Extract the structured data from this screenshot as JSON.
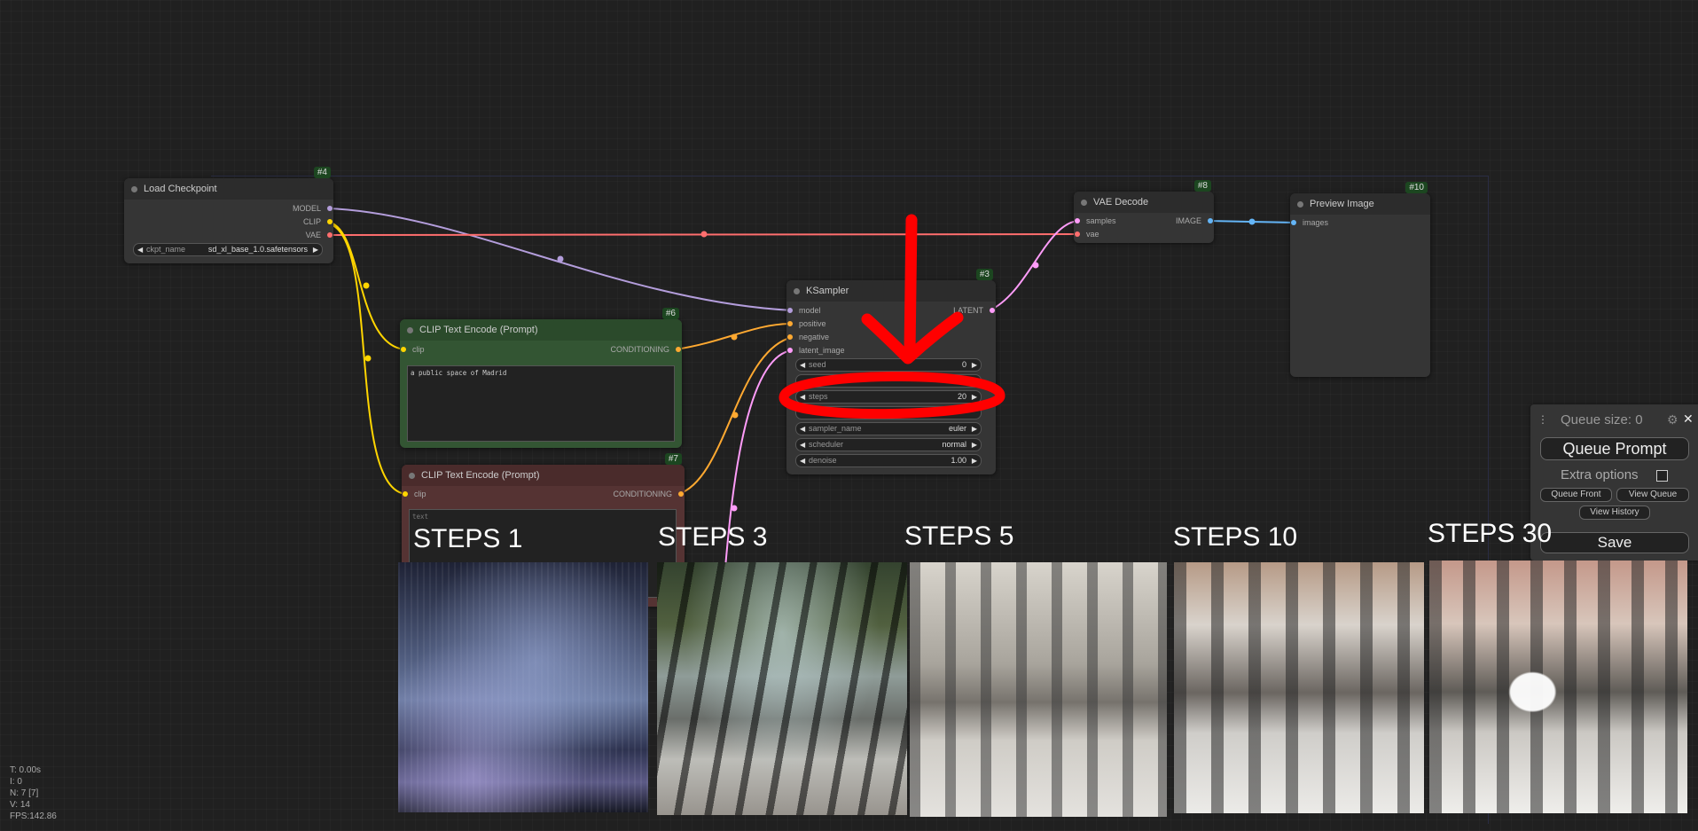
{
  "nodes": {
    "load_checkpoint": {
      "id": "#4",
      "title": "Load Checkpoint",
      "outputs": [
        "MODEL",
        "CLIP",
        "VAE"
      ],
      "ckpt_name_label": "ckpt_name",
      "ckpt_name_value": "sd_xl_base_1.0.safetensors"
    },
    "clip_pos": {
      "id": "#6",
      "title": "CLIP Text Encode (Prompt)",
      "input": "clip",
      "output": "CONDITIONING",
      "text": "a public space of Madrid"
    },
    "clip_neg": {
      "id": "#7",
      "title": "CLIP Text Encode (Prompt)",
      "input": "clip",
      "output": "CONDITIONING",
      "placeholder": "text"
    },
    "ksampler": {
      "id": "#3",
      "title": "KSampler",
      "inputs": [
        "model",
        "positive",
        "negative",
        "latent_image"
      ],
      "output": "LATENT",
      "widgets": [
        {
          "name": "seed",
          "value": "0"
        },
        {
          "name": "steps",
          "value": "20"
        },
        {
          "name": "sampler_name",
          "value": "euler"
        },
        {
          "name": "scheduler",
          "value": "normal"
        },
        {
          "name": "denoise",
          "value": "1.00"
        }
      ]
    },
    "vae_decode": {
      "id": "#8",
      "title": "VAE Decode",
      "inputs": [
        "samples",
        "vae"
      ],
      "output": "IMAGE"
    },
    "preview": {
      "id": "#10",
      "title": "Preview Image",
      "input": "images"
    }
  },
  "queue": {
    "size_label": "Queue size: 0",
    "queue_prompt": "Queue Prompt",
    "extra_options": "Extra options",
    "queue_front": "Queue Front",
    "view_queue": "View Queue",
    "view_history": "View History",
    "save": "Save"
  },
  "comparison": {
    "labels": [
      "STEPS 1",
      "STEPS 3",
      "STEPS 5",
      "STEPS 10",
      "STEPS 30"
    ]
  },
  "stats": {
    "t": "T: 0.00s",
    "i": "I: 0",
    "n": "N: 7 [7]",
    "v": "V: 14",
    "fps": "FPS:142.86"
  },
  "colors": {
    "model": "#b39ddb",
    "clip": "#ffd500",
    "vae": "#ff6e6e",
    "conditioning": "#ffa931",
    "latent": "#ff9cf9",
    "image": "#64b5f6",
    "annotation": "#ff0000"
  }
}
